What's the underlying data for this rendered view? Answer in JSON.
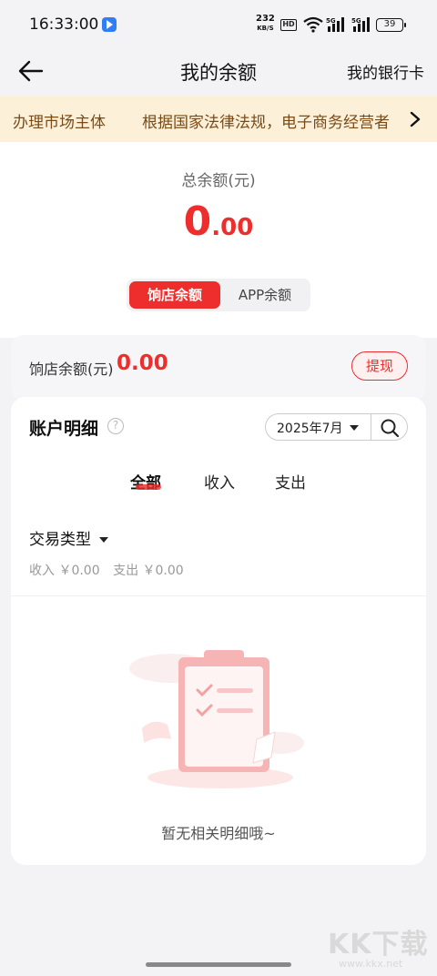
{
  "status_bar": {
    "time": "16:33:00",
    "net_speed_value": "232",
    "net_speed_unit": "KB/S",
    "hd_label": "HD",
    "battery": "39"
  },
  "nav": {
    "title": "我的余额",
    "right_link": "我的银行卡"
  },
  "notice": {
    "text_left": "办理市场主体",
    "text_right": "根据国家法律法规，电子商务经营者"
  },
  "balance": {
    "total_label": "总余额(元)",
    "total_int": "0",
    "total_dec": ".00",
    "segment": {
      "active": "饷店余额",
      "inactive": "APP余额"
    }
  },
  "store_balance": {
    "label": "饷店余额(元)",
    "amount": "0.00",
    "withdraw": "提现"
  },
  "details": {
    "title": "账户明细",
    "help": "?",
    "date": "2025年7月",
    "tabs": [
      "全部",
      "收入",
      "支出"
    ],
    "type_filter": "交易类型",
    "income": "收入 ￥0.00",
    "expense": "支出 ￥0.00",
    "empty": "暂无相关明细哦~"
  },
  "watermark": {
    "logo": "KK下载",
    "url": "www.kkx.net"
  },
  "colors": {
    "accent": "#ee2d2d",
    "notice_bg": "#fdf0d9",
    "notice_text": "#7a4b16"
  }
}
